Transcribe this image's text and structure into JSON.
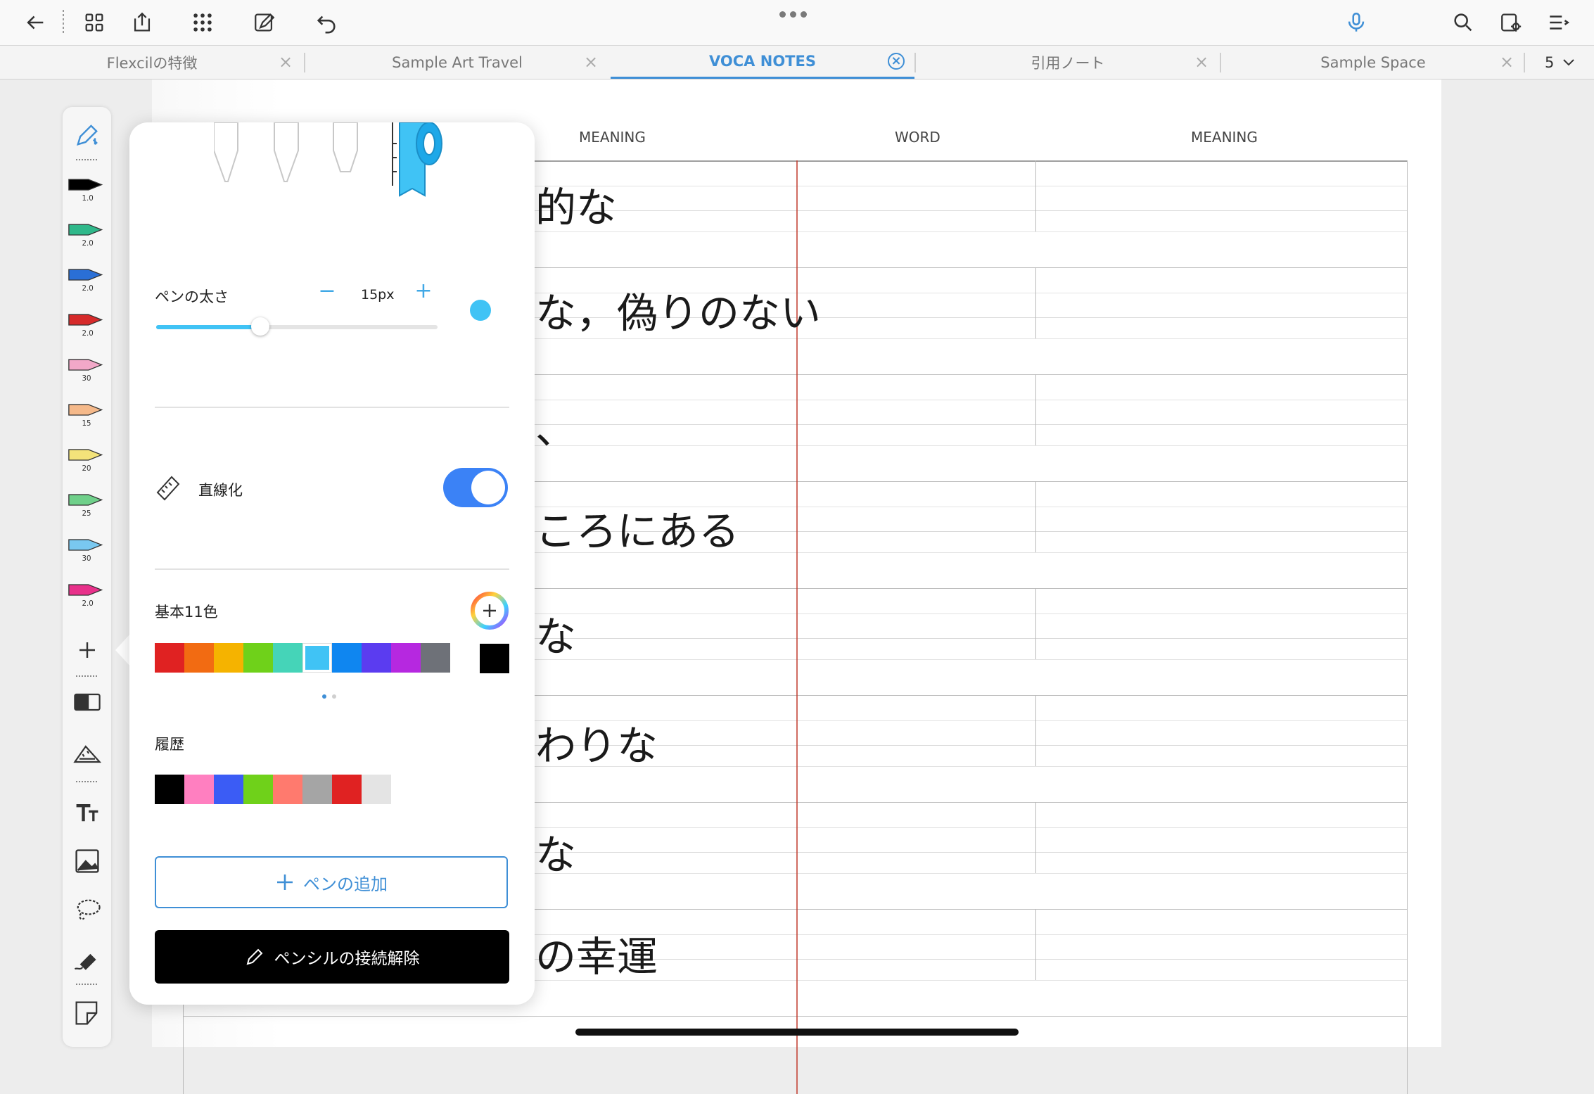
{
  "toolbar": {
    "icons": [
      "back-arrow-icon",
      "grid-icon",
      "share-icon",
      "apps-icon",
      "edit-document-icon",
      "undo-icon",
      "more-dots-icon",
      "microphone-icon",
      "search-icon",
      "document-settings-icon",
      "menu-icon"
    ],
    "accent": "#3f8fd6"
  },
  "tabs": [
    {
      "label": "Flexcilの特徴",
      "active": false
    },
    {
      "label": "Sample Art Travel",
      "active": false
    },
    {
      "label": "VOCA NOTES",
      "active": true
    },
    {
      "label": "引用ノート",
      "active": false
    },
    {
      "label": "Sample Space",
      "active": false
    }
  ],
  "tab_count": "5",
  "page": {
    "headers": [
      "MEANING",
      "WORD",
      "MEANING"
    ],
    "handwriting": [
      "的な",
      "な，偽りのない",
      "、",
      "ころにある",
      "な",
      "わりな",
      "な",
      "の幸運"
    ]
  },
  "rail": {
    "pens": [
      {
        "color": "#000000",
        "size": "1.0"
      },
      {
        "color": "#2fb88a",
        "size": "2.0"
      },
      {
        "color": "#2a6fd6",
        "size": "2.0"
      },
      {
        "color": "#d62a2a",
        "size": "2.0"
      },
      {
        "color": "#f2a8c8",
        "size": "30"
      },
      {
        "color": "#f5b98a",
        "size": "15"
      },
      {
        "color": "#f3e37a",
        "size": "20"
      },
      {
        "color": "#6fd08a",
        "size": "25"
      },
      {
        "color": "#79c8f0",
        "size": "30"
      },
      {
        "color": "#e8308a",
        "size": "2.0"
      }
    ]
  },
  "pen_panel": {
    "thickness_label": "ペンの太さ",
    "thickness_value": "15px",
    "thickness_fraction": 0.37,
    "minus": "−",
    "plus": "+",
    "current_color": "#40c3f5",
    "straighten_label": "直線化",
    "straighten_on": true,
    "basic_colors_label": "基本11色",
    "basic_colors": [
      "#e02222",
      "#f26b12",
      "#f5b300",
      "#6fd11a",
      "#45d4b8",
      "#40c3f5",
      "#0f86f0",
      "#5b3cf0",
      "#b628e0",
      "#6e7178"
    ],
    "black_swatch": "#000000",
    "history_label": "履歴",
    "history_colors": [
      "#000000",
      "#ff7fc0",
      "#3b5cf5",
      "#6fd11a",
      "#ff7a6e",
      "#a5a5a5",
      "#e02222",
      "#e4e4e4"
    ],
    "add_pen_label": "ペンの追加",
    "disconnect_label": "ペンシルの接続解除"
  }
}
